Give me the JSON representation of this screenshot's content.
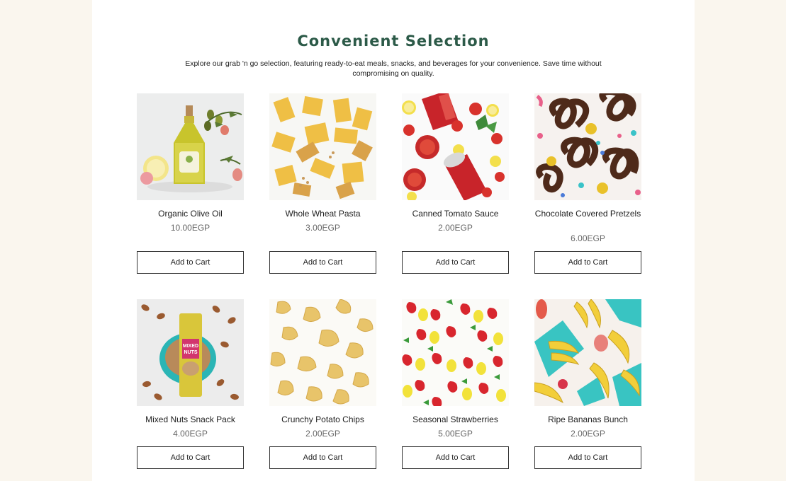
{
  "section": {
    "title": "Convenient Selection",
    "intro": "Explore our grab 'n go selection, featuring ready-to-eat meals, snacks, and beverages for your convenience. Save time without compromising on quality."
  },
  "products": [
    {
      "name": "Organic Olive Oil",
      "price": "10.00EGP",
      "button": "Add to Cart"
    },
    {
      "name": "Whole Wheat Pasta",
      "price": "3.00EGP",
      "button": "Add to Cart"
    },
    {
      "name": "Canned Tomato Sauce",
      "price": "2.00EGP",
      "button": "Add to Cart"
    },
    {
      "name": "Chocolate Covered Pretzels",
      "price": "6.00EGP",
      "button": "Add to Cart"
    },
    {
      "name": "Mixed Nuts Snack Pack",
      "price": "4.00EGP",
      "button": "Add to Cart",
      "package_text": "MIXED NUTS"
    },
    {
      "name": "Crunchy Potato Chips",
      "price": "2.00EGP",
      "button": "Add to Cart"
    },
    {
      "name": "Seasonal Strawberries",
      "price": "5.00EGP",
      "button": "Add to Cart"
    },
    {
      "name": "Ripe Bananas Bunch",
      "price": "2.00EGP",
      "button": "Add to Cart"
    }
  ],
  "colors": {
    "title": "#2c5a48",
    "page_background": "#faf6ee",
    "content_background": "#ffffff",
    "button_border": "#333333"
  }
}
